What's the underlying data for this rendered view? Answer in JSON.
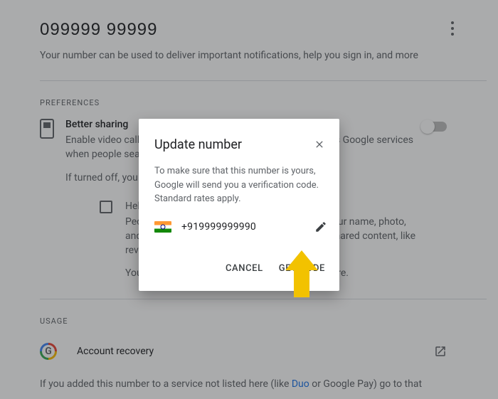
{
  "header": {
    "phone_display": "099999  99999",
    "subtext": "Your number can be used to deliver important notifications, help you sign in, and more"
  },
  "preferences": {
    "section_label": "PREFERENCES",
    "better_sharing": {
      "title": "Better sharing",
      "desc": "Enable video calls, messaging, photo sharing and more across Google services when people search for you by phone number.",
      "off_note": "If turned off, you won't be reachable by phone number."
    },
    "help_people": {
      "title": "Help people find you",
      "desc": "People who have your phone number can see your name, photo, and identify that you are the author of publicly shared content, like reviews on Maps & comments on YouTube.",
      "must_note": "You must enable Better sharing to use this feature."
    }
  },
  "usage": {
    "section_label": "USAGE",
    "account_recovery": "Account recovery"
  },
  "footnote": {
    "prefix": "If you added this number to a service not listed here (like ",
    "link": "Duo",
    "suffix": " or Google Pay) go to that"
  },
  "dialog": {
    "title": "Update number",
    "body": "To make sure that this number is yours, Google will send you a verification code. Standard rates apply.",
    "phone": "+919999999990",
    "cancel": "CANCEL",
    "get_code": "GET CODE"
  }
}
